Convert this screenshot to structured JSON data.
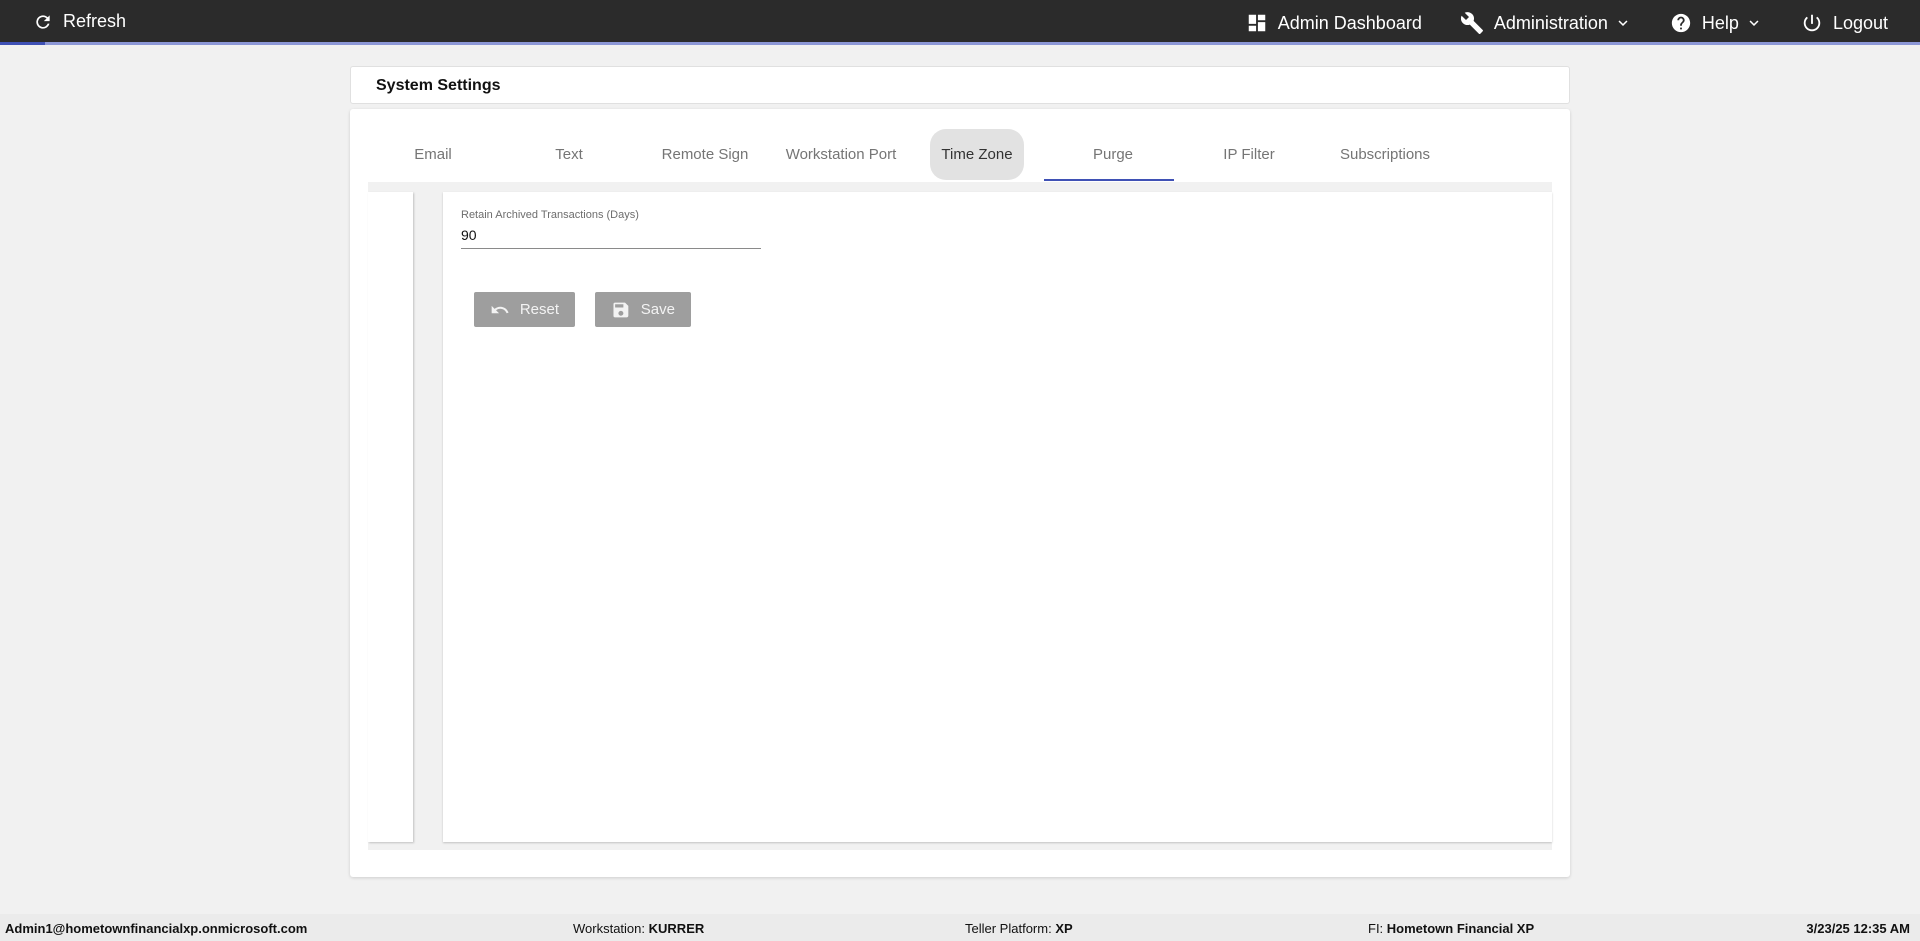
{
  "topbar": {
    "refresh_label": "Refresh",
    "nav": {
      "dashboard_label": "Admin Dashboard",
      "administration_label": "Administration",
      "help_label": "Help",
      "logout_label": "Logout"
    }
  },
  "page": {
    "title": "System Settings"
  },
  "tabs": [
    {
      "label": "Email"
    },
    {
      "label": "Text"
    },
    {
      "label": "Remote Sign"
    },
    {
      "label": "Workstation Port"
    },
    {
      "label": "Time Zone"
    },
    {
      "label": "Purge"
    },
    {
      "label": "IP Filter"
    },
    {
      "label": "Subscriptions"
    }
  ],
  "active_tab": "Purge",
  "purge": {
    "retain_label": "Retain Archived Transactions (Days)",
    "retain_value": "90",
    "reset_label": "Reset",
    "save_label": "Save"
  },
  "footer": {
    "user": "Admin1@hometownfinancialxp.onmicrosoft.com",
    "workstation_label": "Workstation:",
    "workstation_value": "KURRER",
    "platform_label": "Teller Platform:",
    "platform_value": "XP",
    "fi_label": "FI:",
    "fi_value": "Hometown Financial XP",
    "datetime": "3/23/25 12:35 AM"
  },
  "colors": {
    "topbar_bg": "#2b2b2b",
    "accent": "#3f51b5",
    "button_disabled": "#9e9e9e"
  }
}
